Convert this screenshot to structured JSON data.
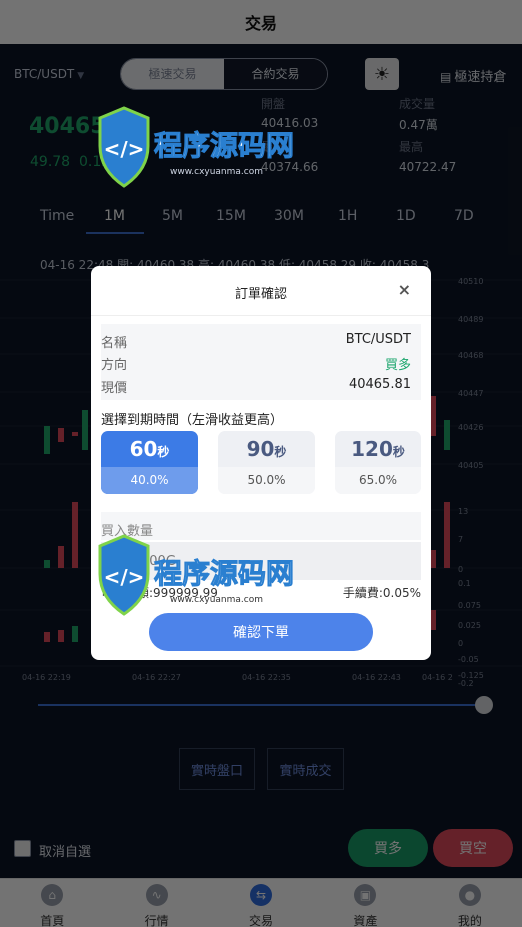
{
  "header": {
    "title": "交易"
  },
  "top": {
    "pair_base": "BTC",
    "pair_quote": "/USDT",
    "segment": [
      "極速交易",
      "合約交易"
    ],
    "hold_label": "極速持倉"
  },
  "stats": {
    "price": "40465",
    "change_abs": "49.78",
    "change_pct": "0.12%",
    "open_label": "開盤",
    "open_value": "40416.03",
    "volume_label": "成交量",
    "volume_value": "0.47萬",
    "low_label": "最低",
    "low_value": "40374.66",
    "high_label": "最高",
    "high_value": "40722.47"
  },
  "timeframes": [
    "Time",
    "1M",
    "5M",
    "15M",
    "30M",
    "1H",
    "1D",
    "7D"
  ],
  "ohlc_line": "04-16 22:48 開: 40460.38 高: 40460.38 低: 40458.29 收: 40458.3",
  "chart_axis": {
    "price_ticks": [
      "40510",
      "40489",
      "40468",
      "40447",
      "40426",
      "40405"
    ],
    "volume_ticks": [
      "13",
      "7",
      "0"
    ],
    "macd_ticks": [
      "0.1",
      "0.075",
      "0.025",
      "0",
      "-0.05",
      "-0.125",
      "-0.2"
    ],
    "time_ticks": [
      "04-16 22:19",
      "04-16 22:27",
      "04-16 22:35",
      "04-16 22:43",
      "04-16 2"
    ]
  },
  "links": {
    "depth": "實時盤口",
    "trades": "實時成交"
  },
  "bottom": {
    "checkbox_label": "取消自選",
    "buy": "買多",
    "sell": "買空"
  },
  "tabs": [
    {
      "label": "首頁",
      "icon": "home-icon"
    },
    {
      "label": "行情",
      "icon": "market-icon"
    },
    {
      "label": "交易",
      "icon": "trade-icon"
    },
    {
      "label": "資產",
      "icon": "wallet-icon"
    },
    {
      "label": "我的",
      "icon": "user-icon"
    }
  ],
  "modal": {
    "title": "訂單確認",
    "close": "×",
    "name_label": "名稱",
    "name_value": "BTC/USDT",
    "direction_label": "方向",
    "direction_value": "買多",
    "price_label": "現價",
    "price_value": "40465.81",
    "expiry_title": "選擇到期時間（左滑收益更高）",
    "options": [
      {
        "num": "60",
        "unit": "秒",
        "pct": "40.0%"
      },
      {
        "num": "90",
        "unit": "秒",
        "pct": "50.0%"
      },
      {
        "num": "120",
        "unit": "秒",
        "pct": "65.0%"
      }
    ],
    "qty_label": "買入數量",
    "qty_placeholder": "100G",
    "available": "可用餘額:999999.99",
    "fee": "手續費:0.05%",
    "confirm": "確認下單"
  },
  "watermark": {
    "text": "程序源码网",
    "url": "www.cxyuanma.com"
  },
  "colors": {
    "up": "#1fa96b",
    "down": "#e04a5c",
    "accent": "#4d83ea"
  }
}
